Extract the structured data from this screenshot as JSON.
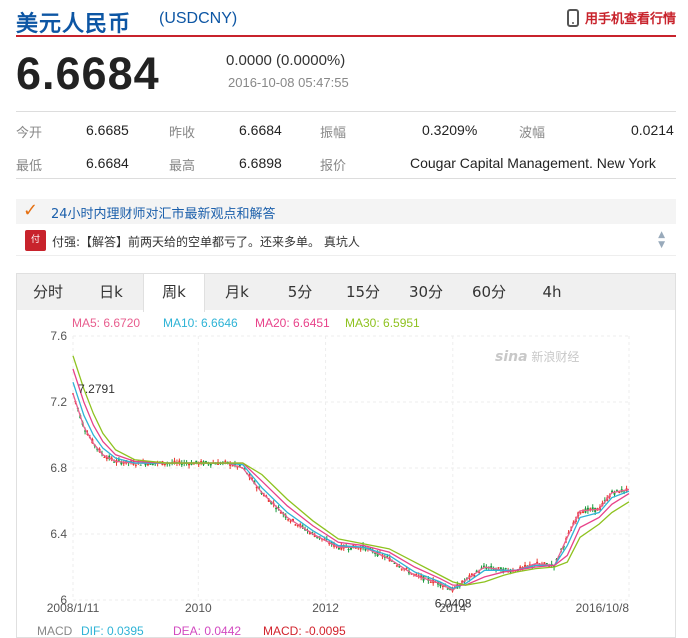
{
  "header": {
    "title": "美元人民币",
    "code": "(USDCNY)",
    "mobile_link": "用手机查看行情"
  },
  "quote": {
    "price": "6.6684",
    "change": "0.0000 (0.0000%)",
    "time": "2016-10-08 05:47:55"
  },
  "stats": [
    [
      {
        "label": "今开",
        "value": "6.6685"
      },
      {
        "label": "昨收",
        "value": "6.6684"
      },
      {
        "label": "振幅",
        "value": "0.3209%"
      },
      {
        "label": "波幅",
        "value": "0.0214"
      }
    ],
    [
      {
        "label": "最低",
        "value": "6.6684"
      },
      {
        "label": "最高",
        "value": "6.6898"
      },
      {
        "label": "报价",
        "value": "Cougar Capital Management. New York"
      }
    ]
  ],
  "news": {
    "headline": "24小时内理财师对汇市最新观点和解答",
    "feed_text": "付强:【解答】前两天给的空单都亏了。还来多单。 真坑人"
  },
  "tabs": [
    "分时",
    "日k",
    "周k",
    "月k",
    "5分",
    "15分",
    "30分",
    "60分",
    "4h"
  ],
  "active_tab": "周k",
  "watermark": {
    "logo": "sina",
    "text": "新浪财经"
  },
  "ma_legend": [
    {
      "label": "MA5: 6.6720",
      "color": "#e85d8e"
    },
    {
      "label": "MA10: 6.6646",
      "color": "#2eb3d6"
    },
    {
      "label": "MA20: 6.6451",
      "color": "#e8428a"
    },
    {
      "label": "MA30: 6.5951",
      "color": "#8ec21f"
    }
  ],
  "macd_legend": [
    {
      "label": "MACD",
      "color": "#888888"
    },
    {
      "label": "DIF: 0.0395",
      "color": "#2eb3d6"
    },
    {
      "label": "DEA: 0.0442",
      "color": "#d24ac0"
    },
    {
      "label": "MACD: -0.0095",
      "color": "#d2232c"
    }
  ],
  "chart_data": {
    "type": "line",
    "y_ticks": [
      "7.6",
      "7.2",
      "6.8",
      "6.4",
      "6"
    ],
    "ylim": [
      6.0,
      7.6
    ],
    "x_ticks": [
      "2008/1/11",
      "2010",
      "2012",
      "2014",
      "2016/10/8"
    ],
    "annotations": [
      {
        "text": "7.2791",
        "x": "2008/1",
        "y": 7.2791
      },
      {
        "text": "6.0408",
        "x": "2014/1",
        "y": 6.0408
      }
    ],
    "series": [
      {
        "name": "MA5",
        "color": "#e85d8e",
        "x": [
          2008.03,
          2008.2,
          2008.35,
          2008.5,
          2008.7,
          2009.0,
          2009.5,
          2010.0,
          2010.45,
          2010.7,
          2011.0,
          2011.4,
          2011.8,
          2012.2,
          2012.6,
          2013.0,
          2013.4,
          2013.8,
          2014.0,
          2014.2,
          2014.5,
          2014.8,
          2015.0,
          2015.3,
          2015.6,
          2015.8,
          2016.0,
          2016.3,
          2016.5,
          2016.77
        ],
        "y": [
          7.25,
          7.05,
          6.95,
          6.88,
          6.84,
          6.83,
          6.83,
          6.83,
          6.83,
          6.8,
          6.65,
          6.5,
          6.4,
          6.32,
          6.32,
          6.25,
          6.15,
          6.1,
          6.06,
          6.12,
          6.2,
          6.18,
          6.18,
          6.22,
          6.21,
          6.38,
          6.54,
          6.55,
          6.65,
          6.67
        ]
      },
      {
        "name": "MA10",
        "color": "#2eb3d6",
        "x": [
          2008.03,
          2008.2,
          2008.35,
          2008.5,
          2008.7,
          2009.0,
          2009.5,
          2010.0,
          2010.45,
          2010.7,
          2011.0,
          2011.4,
          2011.8,
          2012.2,
          2012.6,
          2013.0,
          2013.4,
          2013.8,
          2014.0,
          2014.2,
          2014.5,
          2014.8,
          2015.0,
          2015.3,
          2015.6,
          2015.8,
          2016.0,
          2016.3,
          2016.5,
          2016.77
        ],
        "y": [
          7.32,
          7.12,
          7.0,
          6.92,
          6.86,
          6.83,
          6.83,
          6.83,
          6.83,
          6.82,
          6.68,
          6.53,
          6.42,
          6.33,
          6.32,
          6.27,
          6.17,
          6.11,
          6.07,
          6.1,
          6.18,
          6.18,
          6.18,
          6.21,
          6.21,
          6.33,
          6.5,
          6.53,
          6.62,
          6.66
        ]
      },
      {
        "name": "MA20",
        "color": "#e8428a",
        "x": [
          2008.03,
          2008.2,
          2008.35,
          2008.5,
          2008.7,
          2009.0,
          2009.5,
          2010.0,
          2010.45,
          2010.7,
          2011.0,
          2011.4,
          2011.8,
          2012.2,
          2012.6,
          2013.0,
          2013.4,
          2013.8,
          2014.0,
          2014.2,
          2014.5,
          2014.8,
          2015.0,
          2015.3,
          2015.6,
          2015.8,
          2016.0,
          2016.3,
          2016.5,
          2016.77
        ],
        "y": [
          7.4,
          7.2,
          7.06,
          6.96,
          6.88,
          6.84,
          6.83,
          6.83,
          6.83,
          6.83,
          6.72,
          6.57,
          6.45,
          6.35,
          6.33,
          6.29,
          6.2,
          6.13,
          6.09,
          6.09,
          6.14,
          6.17,
          6.18,
          6.2,
          6.21,
          6.27,
          6.44,
          6.5,
          6.58,
          6.645
        ]
      },
      {
        "name": "MA30",
        "color": "#8ec21f",
        "x": [
          2008.03,
          2008.2,
          2008.35,
          2008.5,
          2008.7,
          2009.0,
          2009.5,
          2010.0,
          2010.45,
          2010.7,
          2011.0,
          2011.4,
          2011.8,
          2012.2,
          2012.6,
          2013.0,
          2013.4,
          2013.8,
          2014.0,
          2014.2,
          2014.5,
          2014.8,
          2015.0,
          2015.3,
          2015.6,
          2015.8,
          2016.0,
          2016.3,
          2016.5,
          2016.77
        ],
        "y": [
          7.48,
          7.28,
          7.13,
          7.01,
          6.91,
          6.85,
          6.83,
          6.83,
          6.83,
          6.83,
          6.76,
          6.61,
          6.48,
          6.37,
          6.34,
          6.31,
          6.23,
          6.15,
          6.11,
          6.09,
          6.11,
          6.15,
          6.17,
          6.19,
          6.2,
          6.23,
          6.38,
          6.46,
          6.53,
          6.595
        ]
      }
    ]
  }
}
